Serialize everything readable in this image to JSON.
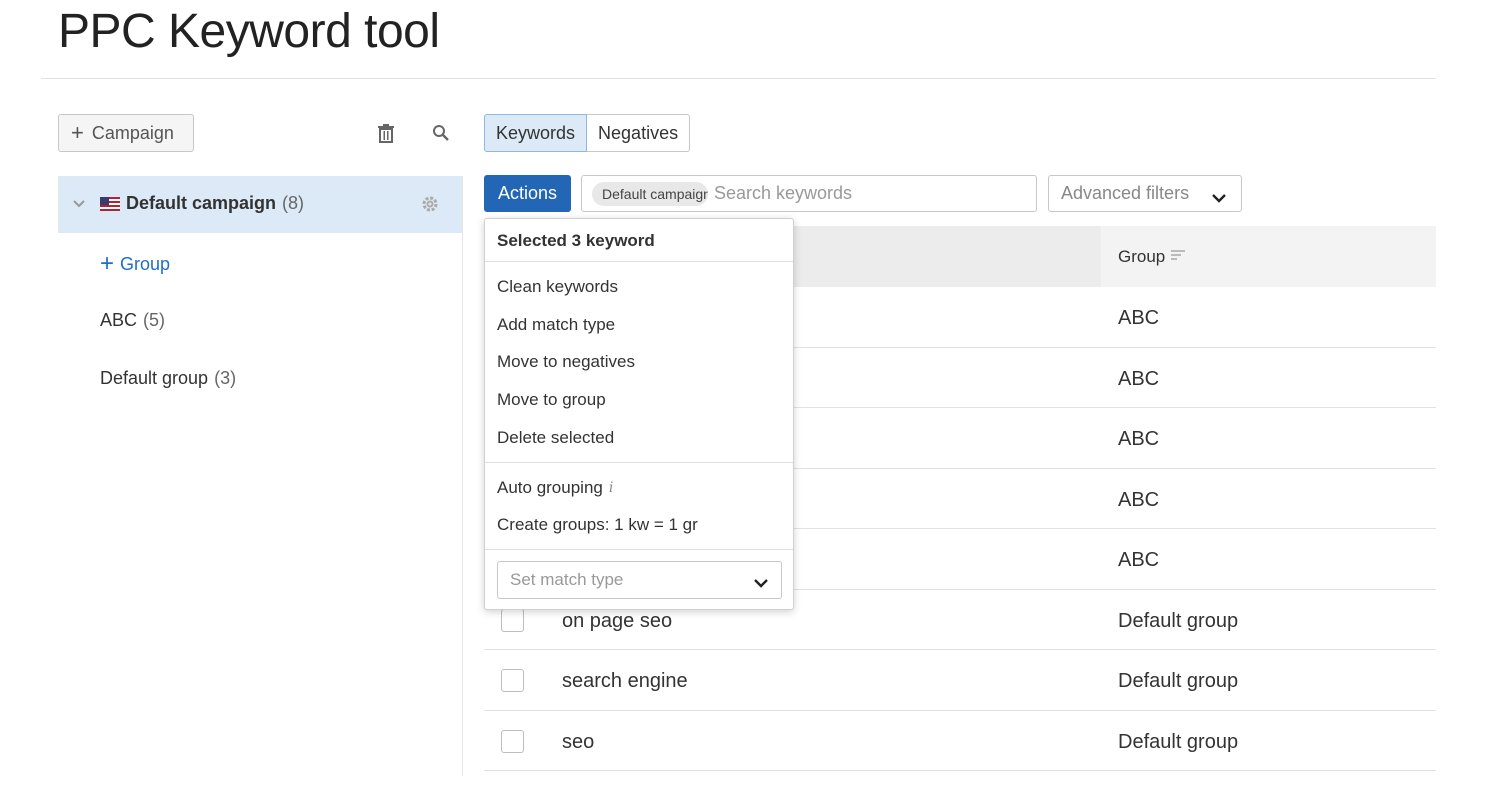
{
  "page": {
    "title": "PPC Keyword tool"
  },
  "sidebar": {
    "add_campaign_label": "Campaign",
    "campaign": {
      "name": "Default campaign",
      "count": "(8)",
      "flag": "us-flag-icon"
    },
    "add_group_label": "Group",
    "groups": [
      {
        "name": "ABC",
        "count": "(5)"
      },
      {
        "name": "Default group",
        "count": "(3)"
      }
    ]
  },
  "tabs": [
    {
      "label": "Keywords",
      "active": true
    },
    {
      "label": "Negatives",
      "active": false
    }
  ],
  "toolbar": {
    "actions_label": "Actions",
    "chip_label": "Default campaign",
    "search_placeholder": "Search keywords",
    "advanced_filters_label": "Advanced filters"
  },
  "table": {
    "columns": {
      "group": "Group"
    },
    "rows": [
      {
        "keyword": "",
        "group": "ABC"
      },
      {
        "keyword": "",
        "group": "ABC"
      },
      {
        "keyword": "",
        "group": "ABC"
      },
      {
        "keyword": "",
        "group": "ABC"
      },
      {
        "keyword": "",
        "group": "ABC"
      },
      {
        "keyword": "on page seo",
        "group": "Default group"
      },
      {
        "keyword": "search engine",
        "group": "Default group"
      },
      {
        "keyword": "seo",
        "group": "Default group"
      }
    ]
  },
  "actions_menu": {
    "header": "Selected 3 keyword",
    "items_main": [
      "Clean keywords",
      "Add match type",
      "Move to negatives",
      "Move to group",
      "Delete selected"
    ],
    "auto_grouping": "Auto grouping",
    "create_groups": "Create groups: 1 kw = 1 gr",
    "match_type_placeholder": "Set match type"
  },
  "colors": {
    "accent": "#2466b6",
    "selected_bg": "#dce9f6",
    "link": "#1f6fc4"
  }
}
